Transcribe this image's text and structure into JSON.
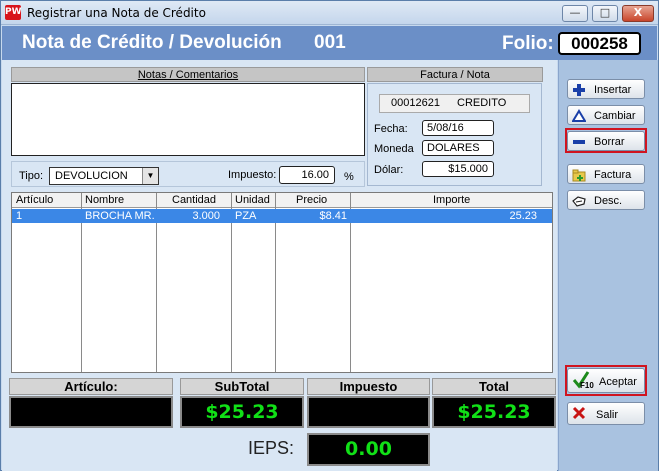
{
  "window": {
    "app_logo": "PW",
    "title": "Registrar una Nota de Crédito",
    "minimize": "—",
    "maximize": "□",
    "close": "X"
  },
  "header": {
    "title": "Nota de Crédito / Devolución",
    "number": "001",
    "folio_label": "Folio:",
    "folio_value": "000258"
  },
  "notes": {
    "label": "Notas / Comentarios",
    "value": ""
  },
  "factura": {
    "label": "Factura / Nota",
    "number": "00012621",
    "type": "CREDITO",
    "fecha_label": "Fecha:",
    "fecha_value": "5/08/16",
    "moneda_label": "Moneda",
    "moneda_value": "DOLARES",
    "dolar_label": "Dólar:",
    "dolar_value": "$15.000"
  },
  "tipo": {
    "label": "Tipo:",
    "value": "DEVOLUCION",
    "impuesto_label": "Impuesto:",
    "impuesto_value": "16.00",
    "percent": "%"
  },
  "grid": {
    "columns": [
      "Artículo",
      "Nombre",
      "Cantidad",
      "Unidad",
      "Precio",
      "Importe"
    ],
    "rows": [
      {
        "articulo": "1",
        "nombre": "BROCHA MR. F",
        "cantidad": "3.000",
        "unidad": "PZA",
        "precio": "$8.41",
        "importe": "25.23"
      }
    ]
  },
  "totals": {
    "articulo_label": "Artículo:",
    "articulo_value": "",
    "subtotal_label": "SubTotal",
    "subtotal_value": "$25.23",
    "impuesto_label": "Impuesto",
    "impuesto_value": "",
    "total_label": "Total",
    "total_value": "$25.23",
    "ieps_label": "IEPS:",
    "ieps_value": "0.00"
  },
  "actions": {
    "insertar": "Insertar",
    "cambiar": "Cambiar",
    "borrar": "Borrar",
    "factura": "Factura",
    "desc": "Desc.",
    "aceptar": "Aceptar",
    "aceptar_key": "F10",
    "salir": "Salir"
  }
}
